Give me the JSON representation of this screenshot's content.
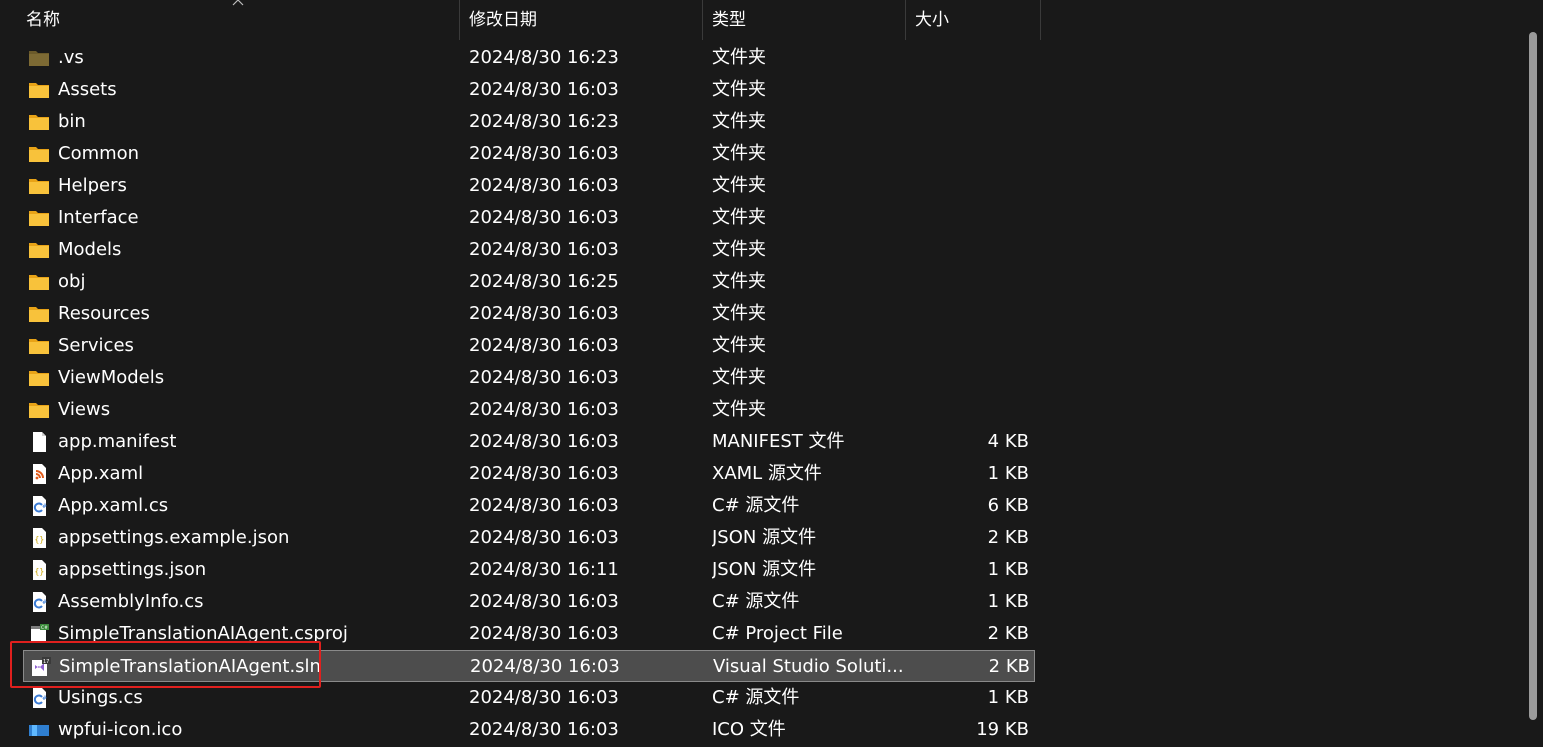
{
  "columns": {
    "name": "名称",
    "date": "修改日期",
    "type": "类型",
    "size": "大小"
  },
  "colors": {
    "background": "#191919",
    "folder": "#f8c23b",
    "selection": "#4d4d4d",
    "highlight_box": "#e0201e"
  },
  "files": [
    {
      "name": ".vs",
      "date": "2024/8/30 16:23",
      "type": "文件夹",
      "size": "",
      "icon": "folder-icon-dim"
    },
    {
      "name": "Assets",
      "date": "2024/8/30 16:03",
      "type": "文件夹",
      "size": "",
      "icon": "folder-icon"
    },
    {
      "name": "bin",
      "date": "2024/8/30 16:23",
      "type": "文件夹",
      "size": "",
      "icon": "folder-icon"
    },
    {
      "name": "Common",
      "date": "2024/8/30 16:03",
      "type": "文件夹",
      "size": "",
      "icon": "folder-icon"
    },
    {
      "name": "Helpers",
      "date": "2024/8/30 16:03",
      "type": "文件夹",
      "size": "",
      "icon": "folder-icon"
    },
    {
      "name": "Interface",
      "date": "2024/8/30 16:03",
      "type": "文件夹",
      "size": "",
      "icon": "folder-icon"
    },
    {
      "name": "Models",
      "date": "2024/8/30 16:03",
      "type": "文件夹",
      "size": "",
      "icon": "folder-icon"
    },
    {
      "name": "obj",
      "date": "2024/8/30 16:25",
      "type": "文件夹",
      "size": "",
      "icon": "folder-icon"
    },
    {
      "name": "Resources",
      "date": "2024/8/30 16:03",
      "type": "文件夹",
      "size": "",
      "icon": "folder-icon"
    },
    {
      "name": "Services",
      "date": "2024/8/30 16:03",
      "type": "文件夹",
      "size": "",
      "icon": "folder-icon"
    },
    {
      "name": "ViewModels",
      "date": "2024/8/30 16:03",
      "type": "文件夹",
      "size": "",
      "icon": "folder-icon"
    },
    {
      "name": "Views",
      "date": "2024/8/30 16:03",
      "type": "文件夹",
      "size": "",
      "icon": "folder-icon"
    },
    {
      "name": "app.manifest",
      "date": "2024/8/30 16:03",
      "type": "MANIFEST 文件",
      "size": "4 KB",
      "icon": "blank-file-icon"
    },
    {
      "name": "App.xaml",
      "date": "2024/8/30 16:03",
      "type": "XAML 源文件",
      "size": "1 KB",
      "icon": "xaml-file-icon"
    },
    {
      "name": "App.xaml.cs",
      "date": "2024/8/30 16:03",
      "type": "C# 源文件",
      "size": "6 KB",
      "icon": "csharp-file-icon"
    },
    {
      "name": "appsettings.example.json",
      "date": "2024/8/30 16:03",
      "type": "JSON 源文件",
      "size": "2 KB",
      "icon": "json-file-icon"
    },
    {
      "name": "appsettings.json",
      "date": "2024/8/30 16:11",
      "type": "JSON 源文件",
      "size": "1 KB",
      "icon": "json-file-icon"
    },
    {
      "name": "AssemblyInfo.cs",
      "date": "2024/8/30 16:03",
      "type": "C# 源文件",
      "size": "1 KB",
      "icon": "csharp-file-icon"
    },
    {
      "name": "SimpleTranslationAIAgent.csproj",
      "date": "2024/8/30 16:03",
      "type": "C# Project File",
      "size": "2 KB",
      "icon": "csproj-file-icon"
    },
    {
      "name": "SimpleTranslationAIAgent.sln",
      "date": "2024/8/30 16:03",
      "type": "Visual Studio Soluti...",
      "size": "2 KB",
      "icon": "visual-studio-solution-icon",
      "selected": true
    },
    {
      "name": "Usings.cs",
      "date": "2024/8/30 16:03",
      "type": "C# 源文件",
      "size": "1 KB",
      "icon": "csharp-file-icon"
    },
    {
      "name": "wpfui-icon.ico",
      "date": "2024/8/30 16:03",
      "type": "ICO 文件",
      "size": "19 KB",
      "icon": "ico-file-icon"
    }
  ]
}
